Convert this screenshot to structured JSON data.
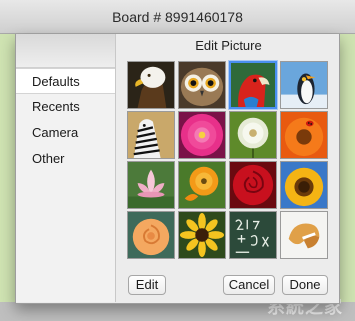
{
  "window": {
    "title": "Board # 8991460178"
  },
  "dialog": {
    "title": "Edit Picture",
    "sidebar": {
      "items": [
        {
          "label": "Defaults",
          "selected": true
        },
        {
          "label": "Recents",
          "selected": false
        },
        {
          "label": "Camera",
          "selected": false
        },
        {
          "label": "Other",
          "selected": false
        }
      ]
    },
    "pictures": [
      {
        "name": "eagle",
        "selected": false
      },
      {
        "name": "owl",
        "selected": false
      },
      {
        "name": "parrot",
        "selected": true
      },
      {
        "name": "penguin",
        "selected": false
      },
      {
        "name": "zebra",
        "selected": false
      },
      {
        "name": "pink-dahlia",
        "selected": false
      },
      {
        "name": "dandelion",
        "selected": false
      },
      {
        "name": "orange-gerbera-ladybug",
        "selected": false
      },
      {
        "name": "lotus",
        "selected": false
      },
      {
        "name": "orange-poppy",
        "selected": false
      },
      {
        "name": "red-rose",
        "selected": false
      },
      {
        "name": "sunflower",
        "selected": false
      },
      {
        "name": "peach-rose",
        "selected": false
      },
      {
        "name": "yellow-daisy",
        "selected": false
      },
      {
        "name": "chalkboard",
        "selected": false
      },
      {
        "name": "fortune-cookie",
        "selected": false
      }
    ],
    "buttons": {
      "edit": "Edit",
      "cancel": "Cancel",
      "done": "Done"
    }
  },
  "colors": {
    "selection_accent": "#4a8ff0",
    "background_green": "#cfe3b2"
  }
}
